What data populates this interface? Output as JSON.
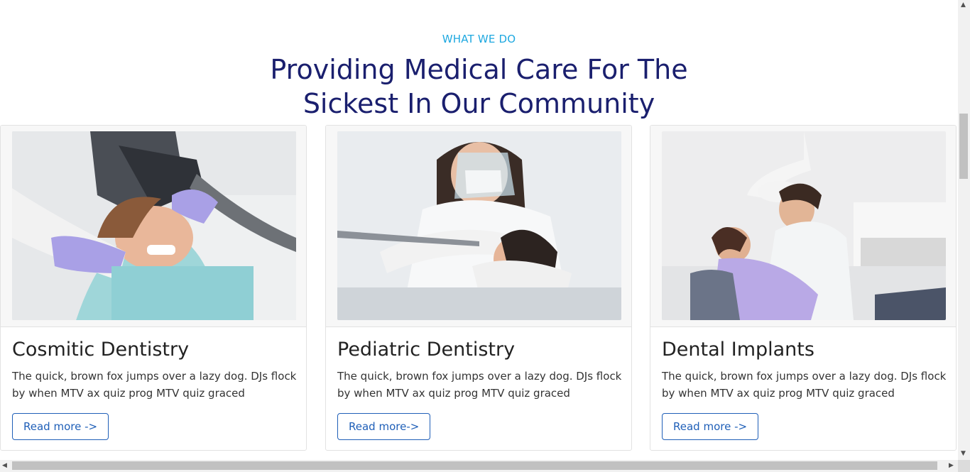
{
  "section": {
    "eyebrow": "WHAT WE DO",
    "heading_line1": "Providing Medical Care For The",
    "heading_line2": "Sickest In Our Community"
  },
  "cards": [
    {
      "title": "Cosmitic Dentistry",
      "text": "The quick, brown fox jumps over a lazy dog. DJs flock by when MTV ax quiz prog MTV quiz graced",
      "button": "Read more ->"
    },
    {
      "title": "Pediatric Dentistry",
      "text": "The quick, brown fox jumps over a lazy dog. DJs flock by when MTV ax quiz prog MTV quiz graced",
      "button": "Read more->"
    },
    {
      "title": "Dental Implants",
      "text": "The quick, brown fox jumps over a lazy dog. DJs flock by when MTV ax quiz prog MTV quiz graced",
      "button": "Read more ->"
    }
  ],
  "scrollbars": {
    "up": "▲",
    "down": "▼",
    "left": "◀",
    "right": "▶"
  },
  "colors": {
    "eyebrow": "#1ea8e0",
    "heading": "#1a1f6e",
    "button": "#1f5fb8"
  }
}
